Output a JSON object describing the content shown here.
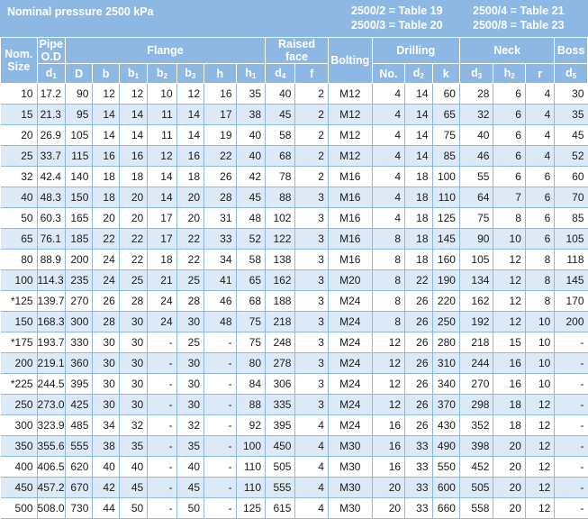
{
  "banner": {
    "title": "Nominal pressure 2500 kPa",
    "ref_a1": "2500/2 = Table 19",
    "ref_a2": "2500/3 = Table 20",
    "ref_b1": "2500/4 = Table 21",
    "ref_b2": "2500/8 = Table 23"
  },
  "headers": {
    "nom_line1": "Nom.",
    "nom_line2": "Size",
    "pipe_line1": "Pipe",
    "pipe_line2": "O.D",
    "flange": "Flange",
    "raised_face": "Raised face",
    "bolting": "Bolting",
    "drilling": "Drilling",
    "neck": "Neck",
    "boss": "Boss",
    "sub": [
      {
        "base": "d",
        "sub": "1"
      },
      {
        "base": "D",
        "sub": ""
      },
      {
        "base": "b",
        "sub": ""
      },
      {
        "base": "b",
        "sub": "1"
      },
      {
        "base": "b",
        "sub": "2"
      },
      {
        "base": "b",
        "sub": "3"
      },
      {
        "base": "h",
        "sub": ""
      },
      {
        "base": "h",
        "sub": "1"
      },
      {
        "base": "d",
        "sub": "4"
      },
      {
        "base": "f",
        "sub": ""
      },
      {
        "base": "No.",
        "sub": ""
      },
      {
        "base": "d",
        "sub": "2"
      },
      {
        "base": "k",
        "sub": ""
      },
      {
        "base": "d",
        "sub": "3"
      },
      {
        "base": "h",
        "sub": "2"
      },
      {
        "base": "r",
        "sub": ""
      },
      {
        "base": "d",
        "sub": "5"
      }
    ]
  },
  "rows": [
    [
      "10",
      "17.2",
      "90",
      "12",
      "12",
      "10",
      "12",
      "16",
      "35",
      "40",
      "2",
      "M12",
      "4",
      "14",
      "60",
      "28",
      "6",
      "4",
      "30"
    ],
    [
      "15",
      "21.3",
      "95",
      "14",
      "14",
      "11",
      "14",
      "17",
      "38",
      "45",
      "2",
      "M12",
      "4",
      "14",
      "65",
      "32",
      "6",
      "4",
      "35"
    ],
    [
      "20",
      "26.9",
      "105",
      "14",
      "14",
      "11",
      "14",
      "19",
      "40",
      "58",
      "2",
      "M12",
      "4",
      "14",
      "75",
      "40",
      "6",
      "4",
      "45"
    ],
    [
      "25",
      "33.7",
      "115",
      "16",
      "16",
      "12",
      "16",
      "22",
      "40",
      "68",
      "2",
      "M12",
      "4",
      "14",
      "85",
      "46",
      "6",
      "4",
      "52"
    ],
    [
      "32",
      "42.4",
      "140",
      "18",
      "18",
      "14",
      "18",
      "26",
      "42",
      "78",
      "2",
      "M16",
      "4",
      "18",
      "100",
      "55",
      "6",
      "6",
      "60"
    ],
    [
      "40",
      "48.3",
      "150",
      "18",
      "20",
      "14",
      "20",
      "28",
      "45",
      "88",
      "3",
      "M16",
      "4",
      "18",
      "110",
      "64",
      "7",
      "6",
      "70"
    ],
    [
      "50",
      "60.3",
      "165",
      "20",
      "20",
      "17",
      "20",
      "31",
      "48",
      "102",
      "3",
      "M16",
      "4",
      "18",
      "125",
      "75",
      "8",
      "6",
      "85"
    ],
    [
      "65",
      "76.1",
      "185",
      "22",
      "22",
      "17",
      "22",
      "33",
      "52",
      "122",
      "3",
      "M16",
      "8",
      "18",
      "145",
      "90",
      "10",
      "6",
      "105"
    ],
    [
      "80",
      "88.9",
      "200",
      "24",
      "22",
      "18",
      "22",
      "34",
      "58",
      "138",
      "3",
      "M16",
      "8",
      "18",
      "160",
      "105",
      "12",
      "8",
      "118"
    ],
    [
      "100",
      "114.3",
      "235",
      "24",
      "25",
      "21",
      "25",
      "41",
      "65",
      "162",
      "3",
      "M20",
      "8",
      "22",
      "190",
      "134",
      "12",
      "8",
      "145"
    ],
    [
      "*125",
      "139.7",
      "270",
      "26",
      "28",
      "24",
      "28",
      "46",
      "68",
      "188",
      "3",
      "M24",
      "8",
      "26",
      "220",
      "162",
      "12",
      "8",
      "170"
    ],
    [
      "150",
      "168.3",
      "300",
      "28",
      "30",
      "24",
      "30",
      "48",
      "75",
      "218",
      "3",
      "M24",
      "8",
      "26",
      "250",
      "192",
      "12",
      "10",
      "200"
    ],
    [
      "*175",
      "193.7",
      "330",
      "30",
      "30",
      "-",
      "25",
      "-",
      "75",
      "248",
      "3",
      "M24",
      "12",
      "26",
      "280",
      "218",
      "15",
      "10",
      "-"
    ],
    [
      "200",
      "219.1",
      "360",
      "30",
      "30",
      "-",
      "30",
      "-",
      "80",
      "278",
      "3",
      "M24",
      "12",
      "26",
      "310",
      "244",
      "16",
      "10",
      "-"
    ],
    [
      "*225",
      "244.5",
      "395",
      "30",
      "30",
      "-",
      "30",
      "-",
      "84",
      "306",
      "3",
      "M24",
      "12",
      "26",
      "340",
      "270",
      "16",
      "10",
      "-"
    ],
    [
      "250",
      "273.0",
      "425",
      "30",
      "30",
      "-",
      "30",
      "-",
      "88",
      "335",
      "3",
      "M24",
      "12",
      "26",
      "370",
      "298",
      "18",
      "12",
      "-"
    ],
    [
      "300",
      "323.9",
      "485",
      "34",
      "32",
      "-",
      "32",
      "-",
      "92",
      "395",
      "4",
      "M24",
      "16",
      "26",
      "430",
      "352",
      "18",
      "12",
      "-"
    ],
    [
      "350",
      "355.6",
      "555",
      "38",
      "35",
      "-",
      "35",
      "-",
      "100",
      "450",
      "4",
      "M30",
      "16",
      "33",
      "490",
      "398",
      "20",
      "12",
      "-"
    ],
    [
      "400",
      "406.5",
      "620",
      "40",
      "40",
      "-",
      "40",
      "-",
      "110",
      "505",
      "4",
      "M30",
      "16",
      "33",
      "550",
      "452",
      "20",
      "12",
      "-"
    ],
    [
      "450",
      "457.2",
      "670",
      "42",
      "45",
      "-",
      "45",
      "-",
      "110",
      "555",
      "4",
      "M30",
      "20",
      "33",
      "600",
      "505",
      "20",
      "12",
      "-"
    ],
    [
      "500",
      "508.0",
      "730",
      "44",
      "50",
      "-",
      "50",
      "-",
      "125",
      "615",
      "4",
      "M30",
      "20",
      "33",
      "660",
      "558",
      "20",
      "12",
      "-"
    ]
  ]
}
